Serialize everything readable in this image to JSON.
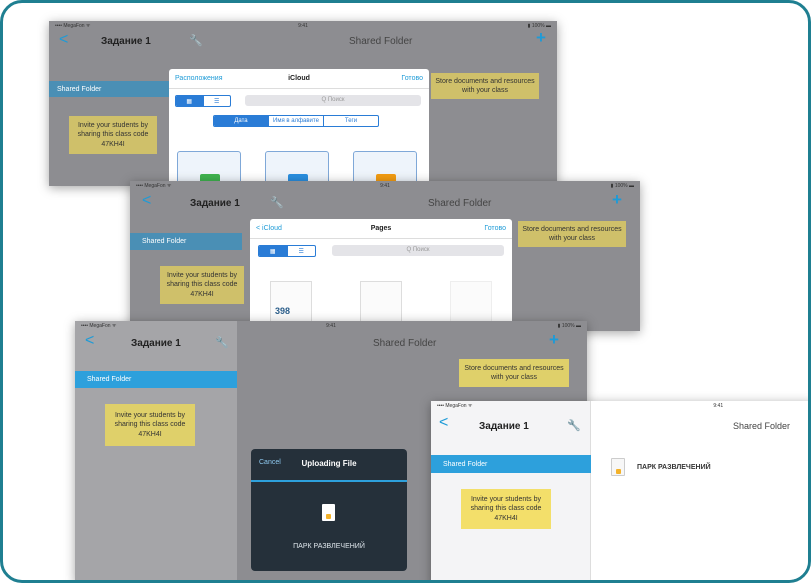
{
  "screens": [
    {
      "status": {
        "carrier": "•••• MegaFon ᯤ",
        "time": "9:41",
        "battery": "▮ 100% ▬"
      },
      "nav": {
        "back": "<",
        "title": "Задание 1",
        "wrench": "🔧",
        "right_title": "Shared Folder",
        "plus": "+"
      },
      "sidebar_item": "Shared Folder",
      "sticky_left": "Invite your students by sharing this class code 47KH4I",
      "sticky_right": "Store documents and resources with your class",
      "popover": {
        "left": "Расположения",
        "title": "iCloud",
        "right": "Готово",
        "view_seg": [
          "▦",
          "☰"
        ],
        "search": "Q Поиск",
        "tabs": [
          "Дата",
          "Имя в алфавите",
          "Теги"
        ],
        "folder_colors": [
          "#3fb34f",
          "#2a8fe0",
          "#f39c12"
        ]
      }
    },
    {
      "status": {
        "carrier": "•••• MegaFon ᯤ",
        "time": "9:41",
        "battery": "▮ 100% ▬"
      },
      "nav": {
        "back": "<",
        "title": "Задание 1",
        "wrench": "🔧",
        "right_title": "Shared Folder",
        "plus": "+"
      },
      "sidebar_item": "Shared Folder",
      "sticky_left": "Invite your students by sharing this class code 47KH4I",
      "sticky_right": "Store documents and resources with your class",
      "popover": {
        "left": "< iCloud",
        "title": "Pages",
        "right": "Готово",
        "view_seg": [
          "▦",
          "☰"
        ],
        "search": "Q Поиск",
        "thumb_label": "398"
      }
    },
    {
      "status": {
        "carrier": "•••• MegaFon ᯤ",
        "time": "9:41",
        "battery": "▮ 100% ▬"
      },
      "nav": {
        "back": "<",
        "title": "Задание 1",
        "wrench": "🔧",
        "right_title": "Shared Folder",
        "plus": "+"
      },
      "sidebar_item": "Shared Folder",
      "sticky_left": "Invite your students by sharing this class code 47KH4I",
      "sticky_right": "Store documents and resources with your class",
      "modal": {
        "cancel": "Cancel",
        "title": "Uploading File",
        "file": "ПАРК РАЗВЛЕЧЕНИЙ"
      }
    },
    {
      "status": {
        "carrier": "•••• MegaFon ᯤ",
        "time": "9:41"
      },
      "nav": {
        "back": "<",
        "title": "Задание 1",
        "wrench": "🔧",
        "right_title": "Shared Folder"
      },
      "sidebar_item": "Shared Folder",
      "sticky_left": "Invite your students by sharing this class code 47KH4I",
      "file_name": "ПАРК РАЗВЛЕЧЕНИЙ"
    }
  ]
}
